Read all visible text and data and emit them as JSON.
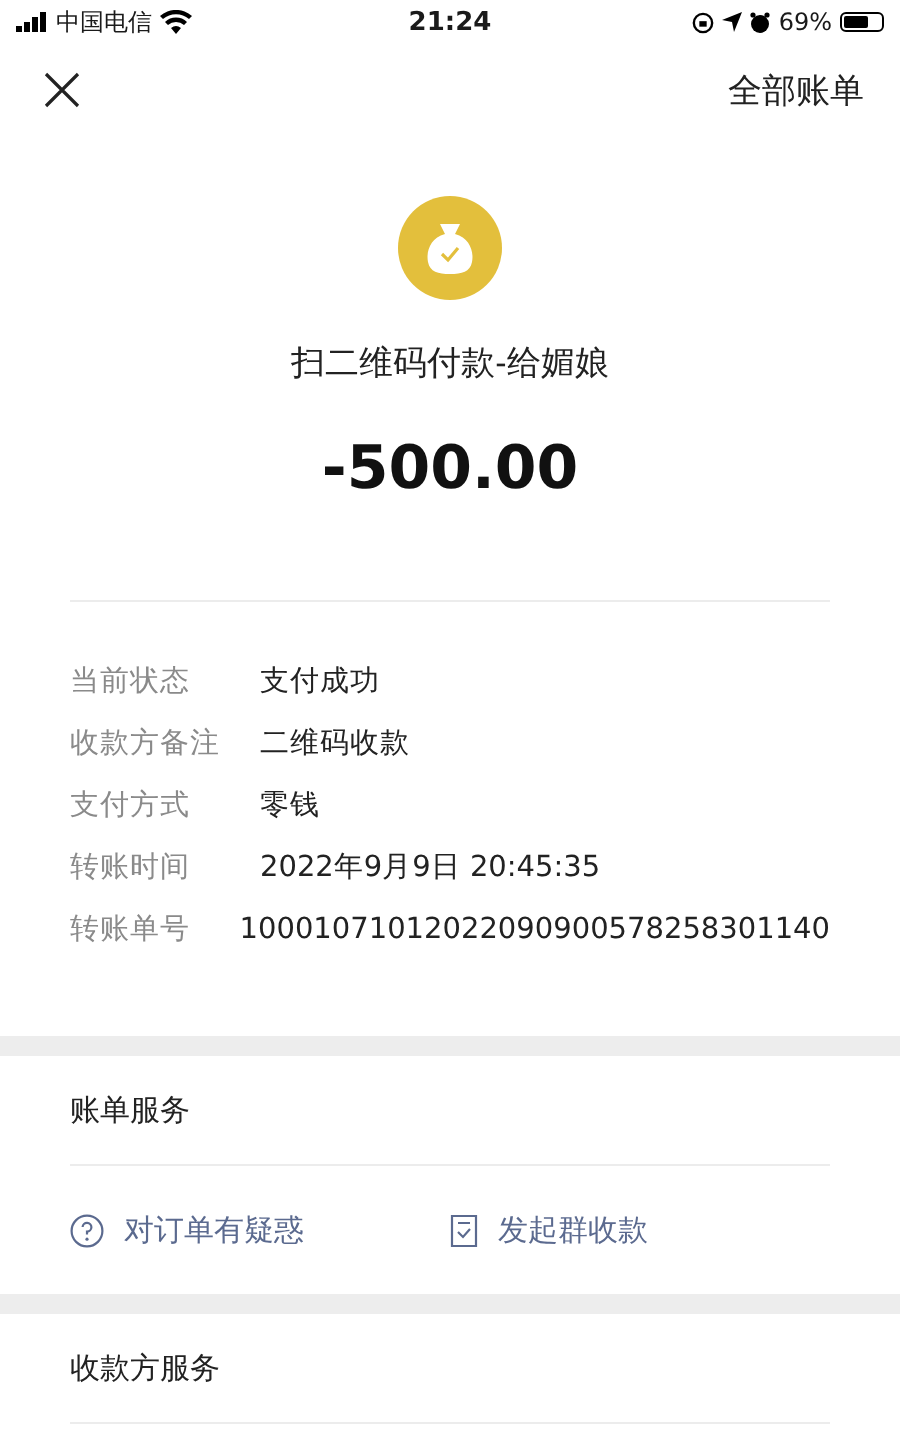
{
  "status_bar": {
    "carrier": "中国电信",
    "time": "21:24",
    "battery": "69%"
  },
  "nav": {
    "action": "全部账单"
  },
  "summary": {
    "title": "扫二维码付款-给媚娘",
    "amount": "-500.00"
  },
  "details": [
    {
      "label": "当前状态",
      "value": "支付成功"
    },
    {
      "label": "收款方备注",
      "value": "二维码收款"
    },
    {
      "label": "支付方式",
      "value": "零钱"
    },
    {
      "label": "转账时间",
      "value": "2022年9月9日 20:45:35"
    },
    {
      "label": "转账单号",
      "value": "10001071012022090900578258301140"
    }
  ],
  "bill_service": {
    "title": "账单服务",
    "actions": [
      {
        "kind": "question",
        "label": "对订单有疑惑"
      },
      {
        "kind": "group",
        "label": "发起群收款"
      }
    ]
  },
  "payee_service": {
    "title": "收款方服务"
  }
}
